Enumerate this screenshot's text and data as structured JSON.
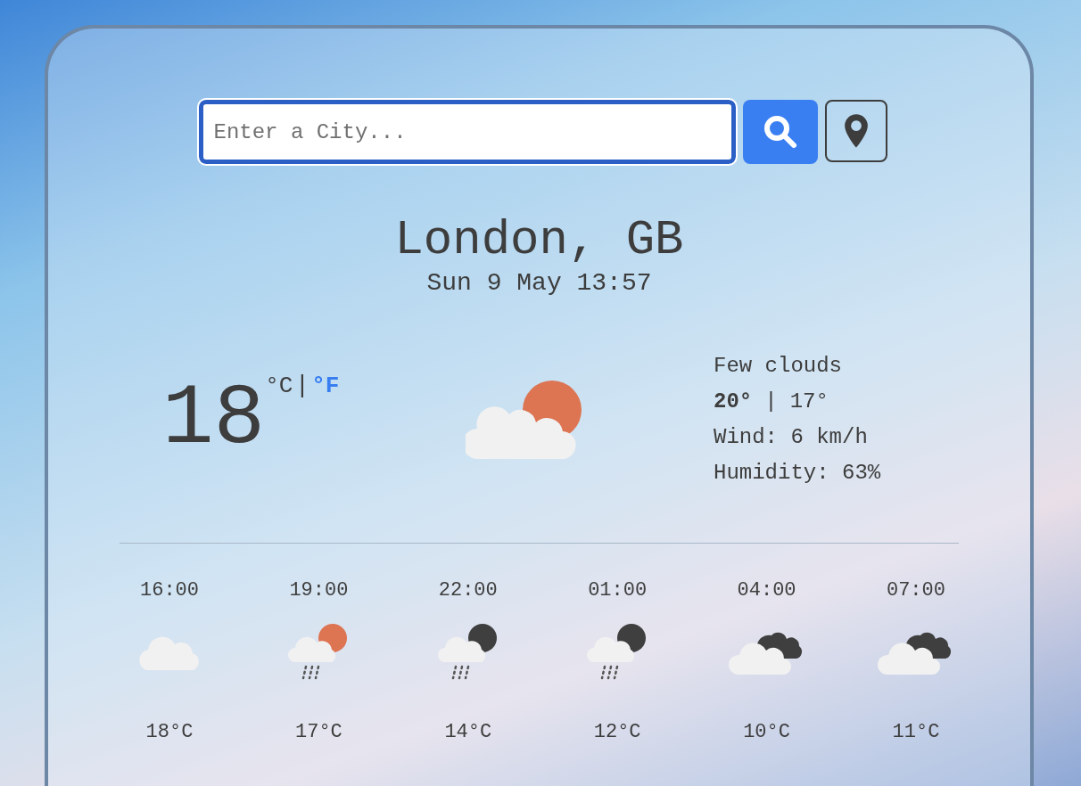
{
  "search": {
    "placeholder": "Enter a City..."
  },
  "location": {
    "city": "London, GB",
    "datetime": "Sun 9 May 13:57"
  },
  "current": {
    "temperature": "18",
    "units": [
      {
        "label": "°C",
        "selected": true
      },
      {
        "label": "°F",
        "selected": false
      }
    ],
    "separator": "|",
    "kind": "cloud-sun",
    "description": "Few clouds",
    "high": "20°",
    "low": "17°",
    "wind": "Wind: 6 km/h",
    "humidity": "Humidity: 63%"
  },
  "forecast": [
    {
      "time": "16:00",
      "kind": "cloud",
      "temp": "18°C"
    },
    {
      "time": "19:00",
      "kind": "rain-sun",
      "temp": "17°C"
    },
    {
      "time": "22:00",
      "kind": "rain-moon",
      "temp": "14°C"
    },
    {
      "time": "01:00",
      "kind": "rain-moon",
      "temp": "12°C"
    },
    {
      "time": "04:00",
      "kind": "clouds-night",
      "temp": "10°C"
    },
    {
      "time": "07:00",
      "kind": "clouds-night",
      "temp": "11°C"
    }
  ]
}
